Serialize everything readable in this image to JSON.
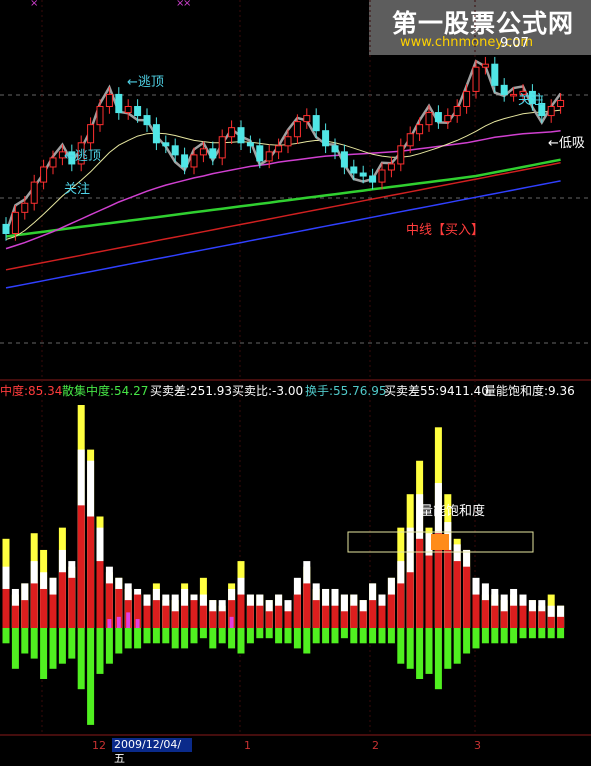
{
  "watermark": {
    "title": "第一股票公式网",
    "url": "www.chnmoney.com"
  },
  "annotations": [
    {
      "text": "←逃顶",
      "color": "#50d2e6"
    },
    {
      "text": "←逃顶",
      "color": "#50d2e6"
    },
    {
      "text": "关注",
      "color": "#50d2e6"
    },
    {
      "text": "关注",
      "color": "#50d2e6"
    },
    {
      "text": "9.07",
      "color": "#ffffff"
    },
    {
      "text": "←低吸",
      "color": "#ffffff"
    },
    {
      "text": "中线【买入】",
      "color": "#ff3c3c"
    }
  ],
  "indicator_bar": [
    {
      "text": "中度:85.34",
      "color": "#ff3c3c"
    },
    {
      "text": "散集中度:54.27",
      "color": "#46e646"
    },
    {
      "text": "买卖差:251.93",
      "color": "#ffffff"
    },
    {
      "text": "买卖比:-3.00",
      "color": "#ffffff"
    },
    {
      "text": "换手:55.76.95",
      "color": "#50c8c8"
    },
    {
      "text": "买卖差55:9411.40",
      "color": "#ffffff"
    },
    {
      "text": "量能饱和度:9.36",
      "color": "#ffffff"
    }
  ],
  "lower_label": "量能饱和度",
  "axis": {
    "date_box": "2009/12/04/五",
    "ticks": [
      "12",
      "1",
      "2",
      "3"
    ]
  },
  "chart_data": [
    {
      "type": "candlestick",
      "title": "",
      "n": 60,
      "open": [
        6.25,
        6.1,
        6.45,
        6.6,
        6.95,
        7.2,
        7.35,
        7.45,
        7.25,
        7.6,
        7.9,
        8.2,
        8.4,
        8.1,
        8.2,
        8.05,
        7.9,
        7.6,
        7.55,
        7.4,
        7.2,
        7.4,
        7.5,
        7.35,
        7.7,
        7.85,
        7.6,
        7.55,
        7.3,
        7.45,
        7.55,
        7.7,
        7.95,
        8.05,
        7.8,
        7.55,
        7.45,
        7.2,
        7.1,
        7.05,
        6.95,
        7.15,
        7.25,
        7.55,
        7.75,
        7.9,
        8.1,
        7.95,
        8.05,
        8.2,
        8.45,
        8.85,
        8.9,
        8.55,
        8.4,
        8.4,
        8.45,
        8.25,
        8.05,
        8.2
      ],
      "close": [
        6.1,
        6.45,
        6.6,
        6.95,
        7.2,
        7.35,
        7.45,
        7.25,
        7.6,
        7.9,
        8.2,
        8.4,
        8.1,
        8.2,
        8.05,
        7.9,
        7.6,
        7.55,
        7.4,
        7.2,
        7.4,
        7.5,
        7.35,
        7.7,
        7.85,
        7.6,
        7.55,
        7.3,
        7.45,
        7.55,
        7.7,
        7.95,
        8.05,
        7.8,
        7.55,
        7.45,
        7.2,
        7.1,
        7.05,
        6.95,
        7.15,
        7.25,
        7.55,
        7.75,
        7.9,
        8.1,
        7.95,
        8.05,
        8.2,
        8.45,
        8.85,
        8.9,
        8.55,
        8.4,
        8.4,
        8.45,
        8.25,
        8.05,
        8.2,
        8.3
      ],
      "ma_yellow": [
        6.0,
        6.05,
        6.15,
        6.28,
        6.42,
        6.57,
        6.72,
        6.85,
        6.98,
        7.12,
        7.28,
        7.44,
        7.56,
        7.64,
        7.71,
        7.75,
        7.76,
        7.75,
        7.72,
        7.68,
        7.64,
        7.62,
        7.6,
        7.6,
        7.61,
        7.62,
        7.61,
        7.59,
        7.57,
        7.56,
        7.57,
        7.59,
        7.62,
        7.64,
        7.63,
        7.6,
        7.56,
        7.51,
        7.46,
        7.41,
        7.38,
        7.36,
        7.36,
        7.38,
        7.42,
        7.47,
        7.52,
        7.58,
        7.64,
        7.71,
        7.79,
        7.88,
        7.95,
        8.0,
        8.04,
        8.08,
        8.1,
        8.11,
        8.12,
        8.14
      ],
      "ma_magenta": [
        5.85,
        5.9,
        5.95,
        6.01,
        6.07,
        6.13,
        6.2,
        6.27,
        6.34,
        6.41,
        6.48,
        6.55,
        6.62,
        6.68,
        6.74,
        6.8,
        6.85,
        6.9,
        6.94,
        6.98,
        7.02,
        7.05,
        7.09,
        7.12,
        7.15,
        7.18,
        7.21,
        7.23,
        7.25,
        7.28,
        7.3,
        7.32,
        7.34,
        7.36,
        7.38,
        7.39,
        7.4,
        7.41,
        7.42,
        7.43,
        7.44,
        7.45,
        7.46,
        7.48,
        7.5,
        7.52,
        7.54,
        7.56,
        7.58,
        7.6,
        7.63,
        7.66,
        7.69,
        7.71,
        7.73,
        7.75,
        7.76,
        7.77,
        7.78,
        7.8
      ],
      "ma_green": [
        6.05,
        6.07,
        6.09,
        6.11,
        6.13,
        6.15,
        6.17,
        6.19,
        6.21,
        6.23,
        6.25,
        6.27,
        6.29,
        6.31,
        6.33,
        6.35,
        6.37,
        6.39,
        6.41,
        6.43,
        6.45,
        6.47,
        6.49,
        6.51,
        6.53,
        6.55,
        6.57,
        6.59,
        6.61,
        6.63,
        6.65,
        6.67,
        6.69,
        6.71,
        6.73,
        6.75,
        6.77,
        6.79,
        6.81,
        6.83,
        6.85,
        6.87,
        6.89,
        6.91,
        6.93,
        6.95,
        6.97,
        6.99,
        7.01,
        7.03,
        7.05,
        7.08,
        7.11,
        7.14,
        7.17,
        7.2,
        7.23,
        7.26,
        7.29,
        7.32
      ],
      "ma_red": [
        5.5,
        5.53,
        5.56,
        5.59,
        5.62,
        5.65,
        5.68,
        5.71,
        5.74,
        5.77,
        5.8,
        5.83,
        5.86,
        5.89,
        5.92,
        5.95,
        5.98,
        6.01,
        6.04,
        6.07,
        6.1,
        6.13,
        6.16,
        6.19,
        6.22,
        6.25,
        6.28,
        6.31,
        6.34,
        6.37,
        6.4,
        6.43,
        6.46,
        6.49,
        6.52,
        6.55,
        6.58,
        6.61,
        6.64,
        6.67,
        6.7,
        6.73,
        6.76,
        6.79,
        6.82,
        6.85,
        6.88,
        6.91,
        6.94,
        6.97,
        7.0,
        7.03,
        7.06,
        7.09,
        7.12,
        7.15,
        7.18,
        7.21,
        7.24,
        7.27
      ],
      "ma_blue": [
        5.2,
        5.23,
        5.26,
        5.29,
        5.32,
        5.35,
        5.38,
        5.41,
        5.44,
        5.47,
        5.5,
        5.53,
        5.56,
        5.59,
        5.62,
        5.65,
        5.68,
        5.71,
        5.74,
        5.77,
        5.8,
        5.83,
        5.86,
        5.89,
        5.92,
        5.95,
        5.98,
        6.01,
        6.04,
        6.07,
        6.1,
        6.13,
        6.16,
        6.19,
        6.22,
        6.25,
        6.28,
        6.31,
        6.34,
        6.37,
        6.4,
        6.43,
        6.46,
        6.49,
        6.52,
        6.55,
        6.58,
        6.61,
        6.64,
        6.67,
        6.7,
        6.73,
        6.76,
        6.79,
        6.82,
        6.85,
        6.88,
        6.91,
        6.94,
        6.97
      ],
      "ylim": [
        5.0,
        9.3
      ],
      "grid": true
    },
    {
      "type": "bar",
      "title": "",
      "n": 60,
      "up_red": [
        35,
        20,
        25,
        40,
        35,
        30,
        50,
        45,
        110,
        100,
        60,
        40,
        35,
        25,
        30,
        20,
        25,
        20,
        15,
        20,
        25,
        20,
        15,
        15,
        25,
        30,
        20,
        20,
        15,
        20,
        15,
        30,
        40,
        25,
        20,
        20,
        15,
        20,
        15,
        25,
        20,
        30,
        40,
        50,
        80,
        65,
        85,
        70,
        60,
        55,
        30,
        25,
        20,
        15,
        20,
        20,
        15,
        15,
        10,
        10
      ],
      "white_top": [
        55,
        35,
        40,
        60,
        50,
        45,
        70,
        60,
        160,
        150,
        90,
        55,
        45,
        40,
        35,
        30,
        35,
        30,
        30,
        35,
        30,
        30,
        25,
        25,
        35,
        45,
        30,
        30,
        25,
        30,
        25,
        45,
        60,
        40,
        35,
        35,
        30,
        30,
        25,
        40,
        30,
        45,
        60,
        90,
        120,
        85,
        130,
        95,
        75,
        70,
        45,
        40,
        35,
        30,
        35,
        30,
        25,
        25,
        20,
        20
      ],
      "yellow_top": [
        80,
        30,
        40,
        85,
        70,
        45,
        90,
        55,
        200,
        160,
        100,
        50,
        45,
        35,
        30,
        30,
        40,
        25,
        25,
        40,
        30,
        45,
        25,
        20,
        40,
        60,
        30,
        30,
        25,
        30,
        20,
        30,
        55,
        35,
        35,
        35,
        30,
        30,
        25,
        40,
        30,
        45,
        90,
        120,
        150,
        90,
        180,
        120,
        80,
        70,
        40,
        30,
        30,
        25,
        30,
        25,
        25,
        20,
        30,
        20
      ],
      "magenta": [
        0,
        0,
        0,
        0,
        0,
        0,
        0,
        0,
        0,
        0,
        0,
        8,
        10,
        14,
        8,
        0,
        0,
        0,
        0,
        0,
        0,
        0,
        0,
        0,
        10,
        0,
        0,
        0,
        0,
        0,
        0,
        0,
        0,
        0,
        0,
        0,
        0,
        0,
        0,
        0,
        0,
        0,
        0,
        0,
        0,
        0,
        0,
        0,
        0,
        0,
        0,
        0,
        0,
        0,
        0,
        0,
        0,
        0,
        0,
        0
      ],
      "green_down": [
        15,
        40,
        25,
        30,
        50,
        40,
        35,
        30,
        60,
        95,
        45,
        35,
        25,
        20,
        20,
        15,
        15,
        15,
        20,
        20,
        15,
        10,
        20,
        15,
        20,
        25,
        15,
        10,
        10,
        15,
        15,
        20,
        25,
        15,
        15,
        15,
        10,
        15,
        15,
        15,
        15,
        15,
        35,
        40,
        50,
        45,
        60,
        40,
        35,
        25,
        20,
        15,
        15,
        15,
        15,
        10,
        10,
        10,
        10,
        10
      ],
      "ylim": [
        -100,
        200
      ],
      "grid": false
    }
  ]
}
